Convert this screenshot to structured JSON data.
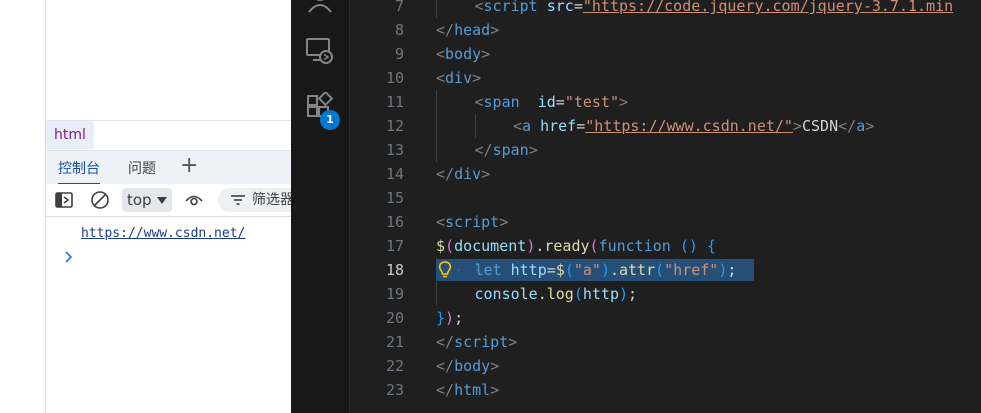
{
  "devtools": {
    "breadcrumb_tag": "html",
    "tabs": [
      {
        "label": "控制台",
        "active": true
      },
      {
        "label": "问题",
        "active": false
      }
    ],
    "add_tab_label": "+",
    "context_selector": "top",
    "filter_label": "筛选器",
    "console_log": "https://www.csdn.net/",
    "prompt_symbol": "›"
  },
  "vscode": {
    "activity_icons": [
      "accounts-icon",
      "remote-explorer-icon",
      "extensions-icon"
    ],
    "extensions_badge": "1",
    "active_line": 18,
    "lines": [
      {
        "n": "7",
        "indent": 1,
        "tokens": [
          {
            "t": "<",
            "c": "#808080"
          },
          {
            "t": "script",
            "c": "#569cd6"
          },
          {
            "t": " ",
            "c": "#d4d4d4"
          },
          {
            "t": "src",
            "c": "#9cdcfe"
          },
          {
            "t": "=",
            "c": "#d4d4d4"
          },
          {
            "t": "\"https://code.jquery.com/jquery-3.7.1.min",
            "c": "#ce9178",
            "u": true
          }
        ]
      },
      {
        "n": "8",
        "indent": 0,
        "tokens": [
          {
            "t": "</",
            "c": "#808080"
          },
          {
            "t": "head",
            "c": "#569cd6"
          },
          {
            "t": ">",
            "c": "#808080"
          }
        ]
      },
      {
        "n": "9",
        "indent": 0,
        "tokens": [
          {
            "t": "<",
            "c": "#808080"
          },
          {
            "t": "body",
            "c": "#569cd6"
          },
          {
            "t": ">",
            "c": "#808080"
          }
        ]
      },
      {
        "n": "10",
        "indent": 0,
        "tokens": [
          {
            "t": "<",
            "c": "#808080"
          },
          {
            "t": "div",
            "c": "#569cd6"
          },
          {
            "t": ">",
            "c": "#808080"
          }
        ]
      },
      {
        "n": "11",
        "indent": 1,
        "tokens": [
          {
            "t": "<",
            "c": "#808080"
          },
          {
            "t": "span",
            "c": "#569cd6"
          },
          {
            "t": "  ",
            "c": "#d4d4d4"
          },
          {
            "t": "id",
            "c": "#9cdcfe"
          },
          {
            "t": "=",
            "c": "#d4d4d4"
          },
          {
            "t": "\"test\"",
            "c": "#ce9178"
          },
          {
            "t": ">",
            "c": "#808080"
          }
        ]
      },
      {
        "n": "12",
        "indent": 2,
        "tokens": [
          {
            "t": "<",
            "c": "#808080"
          },
          {
            "t": "a",
            "c": "#569cd6"
          },
          {
            "t": " ",
            "c": "#d4d4d4"
          },
          {
            "t": "href",
            "c": "#9cdcfe"
          },
          {
            "t": "=",
            "c": "#d4d4d4"
          },
          {
            "t": "\"https://www.csdn.net/\"",
            "c": "#ce9178",
            "u": true
          },
          {
            "t": ">",
            "c": "#808080"
          },
          {
            "t": "CSDN",
            "c": "#d4d4d4"
          },
          {
            "t": "</",
            "c": "#808080"
          },
          {
            "t": "a",
            "c": "#569cd6"
          },
          {
            "t": ">",
            "c": "#808080"
          }
        ]
      },
      {
        "n": "13",
        "indent": 1,
        "tokens": [
          {
            "t": "</",
            "c": "#808080"
          },
          {
            "t": "span",
            "c": "#569cd6"
          },
          {
            "t": ">",
            "c": "#808080"
          }
        ]
      },
      {
        "n": "14",
        "indent": 0,
        "tokens": [
          {
            "t": "</",
            "c": "#808080"
          },
          {
            "t": "div",
            "c": "#569cd6"
          },
          {
            "t": ">",
            "c": "#808080"
          }
        ]
      },
      {
        "n": "15",
        "indent": 0,
        "tokens": []
      },
      {
        "n": "16",
        "indent": 0,
        "tokens": [
          {
            "t": "<",
            "c": "#808080"
          },
          {
            "t": "script",
            "c": "#569cd6"
          },
          {
            "t": ">",
            "c": "#808080"
          }
        ]
      },
      {
        "n": "17",
        "indent": 0,
        "tokens": [
          {
            "t": "$",
            "c": "#dcdcaa"
          },
          {
            "t": "(",
            "c": "#da70d6"
          },
          {
            "t": "document",
            "c": "#9cdcfe"
          },
          {
            "t": ")",
            "c": "#da70d6"
          },
          {
            "t": ".",
            "c": "#d4d4d4"
          },
          {
            "t": "ready",
            "c": "#dcdcaa"
          },
          {
            "t": "(",
            "c": "#da70d6"
          },
          {
            "t": "function",
            "c": "#569cd6"
          },
          {
            "t": " ",
            "c": "#d4d4d4"
          },
          {
            "t": "()",
            "c": "#179fff"
          },
          {
            "t": " ",
            "c": "#d4d4d4"
          },
          {
            "t": "{",
            "c": "#179fff"
          }
        ]
      },
      {
        "n": "18",
        "indent": 1,
        "ws": true,
        "tokens": [
          {
            "t": "let",
            "c": "#569cd6"
          },
          {
            "t": " ",
            "c": "#d4d4d4"
          },
          {
            "t": "http",
            "c": "#9cdcfe"
          },
          {
            "t": "=",
            "c": "#d4d4d4"
          },
          {
            "t": "$",
            "c": "#dcdcaa"
          },
          {
            "t": "(",
            "c": "#179fff"
          },
          {
            "t": "\"a\"",
            "c": "#ce9178"
          },
          {
            "t": ")",
            "c": "#179fff"
          },
          {
            "t": ".",
            "c": "#d4d4d4"
          },
          {
            "t": "attr",
            "c": "#dcdcaa"
          },
          {
            "t": "(",
            "c": "#179fff"
          },
          {
            "t": "\"href\"",
            "c": "#ce9178"
          },
          {
            "t": ")",
            "c": "#179fff"
          },
          {
            "t": ";",
            "c": "#d4d4d4"
          }
        ]
      },
      {
        "n": "19",
        "indent": 1,
        "tokens": [
          {
            "t": "console",
            "c": "#9cdcfe"
          },
          {
            "t": ".",
            "c": "#d4d4d4"
          },
          {
            "t": "log",
            "c": "#dcdcaa"
          },
          {
            "t": "(",
            "c": "#179fff"
          },
          {
            "t": "http",
            "c": "#9cdcfe"
          },
          {
            "t": ")",
            "c": "#179fff"
          },
          {
            "t": ";",
            "c": "#d4d4d4"
          }
        ]
      },
      {
        "n": "20",
        "indent": 0,
        "tokens": [
          {
            "t": "}",
            "c": "#179fff"
          },
          {
            "t": ")",
            "c": "#da70d6"
          },
          {
            "t": ";",
            "c": "#d4d4d4"
          }
        ]
      },
      {
        "n": "21",
        "indent": 0,
        "tokens": [
          {
            "t": "</",
            "c": "#808080"
          },
          {
            "t": "script",
            "c": "#569cd6"
          },
          {
            "t": ">",
            "c": "#808080"
          }
        ]
      },
      {
        "n": "22",
        "indent": 0,
        "tokens": [
          {
            "t": "</",
            "c": "#808080"
          },
          {
            "t": "body",
            "c": "#569cd6"
          },
          {
            "t": ">",
            "c": "#808080"
          }
        ]
      },
      {
        "n": "23",
        "indent": 0,
        "tokens": [
          {
            "t": "</",
            "c": "#808080"
          },
          {
            "t": "html",
            "c": "#569cd6"
          },
          {
            "t": ">",
            "c": "#808080"
          }
        ]
      }
    ]
  }
}
